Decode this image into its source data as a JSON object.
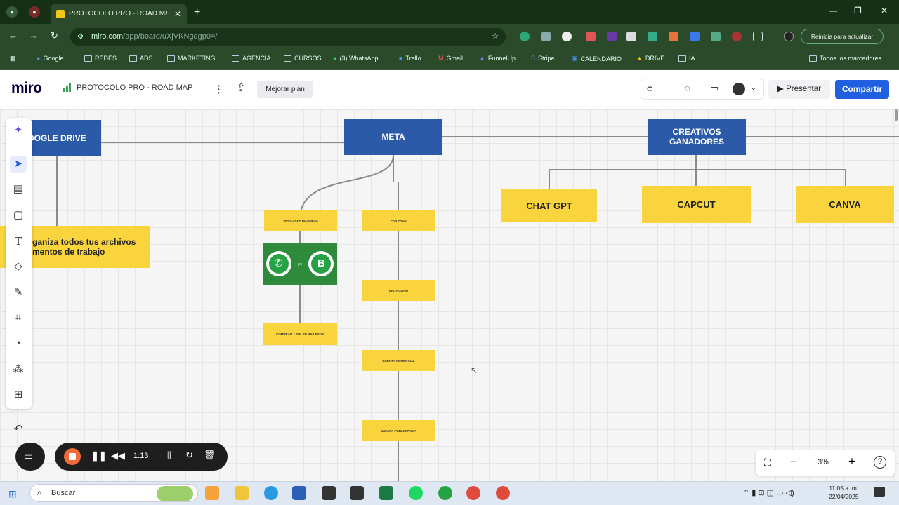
{
  "browser": {
    "tab_title": "PROTOCOLO PRO - ROAD MAP",
    "url_host": "miro.com",
    "url_path": "/app/board/uXjVKNgdgp0=/",
    "update_button": "Reinicia para actualizar",
    "bookmarks": [
      "Google",
      "REDES",
      "ADS",
      "MARKETING",
      "AGENCIA",
      "CURSOS",
      "(3) WhatsApp",
      "Trello",
      "Gmail",
      "FunnelUp",
      "Stripe",
      "CALENDARIO",
      "DRIVE",
      "IA"
    ],
    "all_bookmarks": "Todos los marcadores"
  },
  "miro": {
    "logo": "miro",
    "board_name": "PROTOCOLO PRO - ROAD MAP",
    "upgrade_button": "Mejorar plan",
    "present_button": "Presentar",
    "share_button": "Compartir",
    "zoom": "3%"
  },
  "board": {
    "google_drive": "OOGLE DRIVE",
    "meta": "META",
    "creativos": "CREATIVOS GANADORES",
    "chat_gpt": "CHAT GPT",
    "capcut": "CAPCUT",
    "canva": "CANVA",
    "drive_note_line1": "ganiza todos tus archivos",
    "drive_note_line2": "mentos de trabajo",
    "whatsapp_business": "WHATSAPP BUSINESS",
    "fan_page": "FAN PAGE",
    "instagram": "INSTAGRAM",
    "comprar": "COMPRAR 1 SIM EN BAILEYDR",
    "cuenta_comercial": "CUENTA COMERCIAL",
    "cuenta_publicitaria": "CUENTA PUBLICITARIA"
  },
  "recorder": {
    "time": "1:13"
  },
  "taskbar": {
    "search": "Buscar",
    "time": "11:05 a. m.",
    "date": "22/04/2025"
  },
  "colors": {
    "blue_node": "#2a5aa8",
    "yellow_node": "#f9d43d",
    "share_blue": "#1f5fe0",
    "chrome_green": "#1f3b1f"
  }
}
